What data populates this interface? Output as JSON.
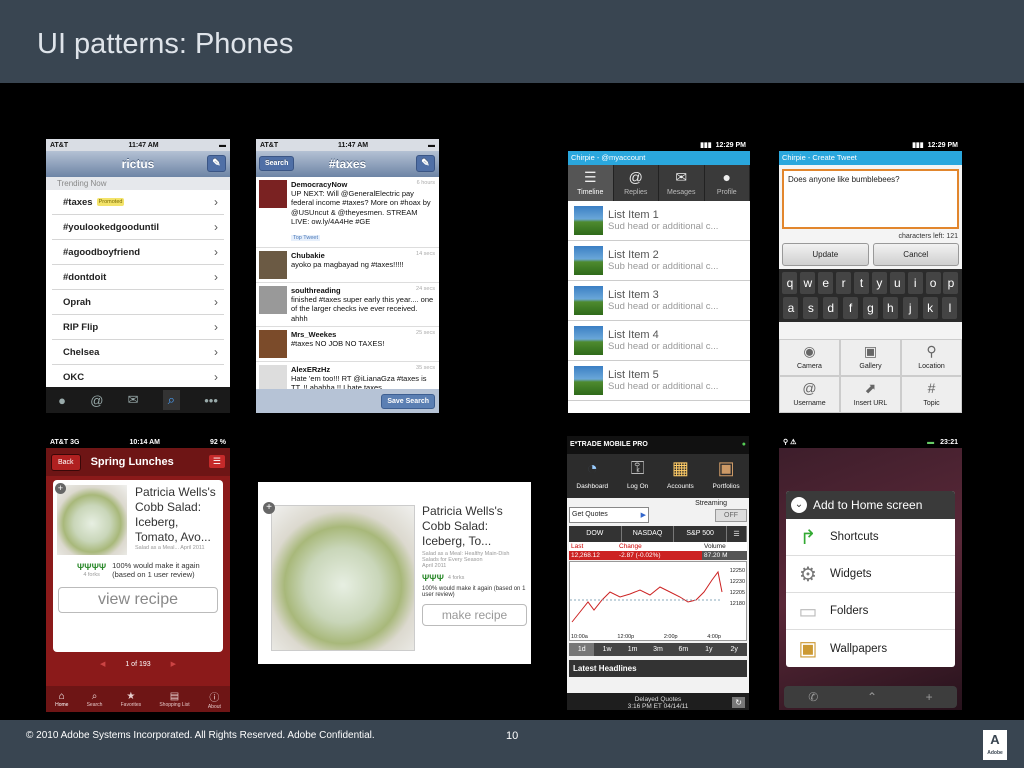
{
  "slide": {
    "title": "UI patterns: Phones",
    "footer": "© 2010 Adobe Systems Incorporated.  All Rights Reserved.  Adobe Confidential.",
    "page": "10",
    "logo": "Adobe"
  },
  "phone1": {
    "carrier": "AT&T",
    "time": "11:47 AM",
    "title": "rictus",
    "section": "Trending Now",
    "promoted": "Promoted",
    "items": [
      "#taxes",
      "#youlookedgooduntil",
      "#agoodboyfriend",
      "#dontdoit",
      "Oprah",
      "RIP Flip",
      "Chelsea",
      "OKC"
    ]
  },
  "phone2": {
    "carrier": "AT&T",
    "time": "11:47 AM",
    "back": "Search",
    "title": "#taxes",
    "save": "Save Search",
    "top_tweet": "Top Tweet",
    "tweets": [
      {
        "user": "DemocracyNow",
        "time": "6 hours",
        "text": "UP NEXT: Will @GeneralElectric pay federal income #taxes? More on #hoax by @USUncut & @theyesmen. STREAM LIVE: ow.ly/4A4He #GE"
      },
      {
        "user": "Chubakie",
        "time": "14 secs",
        "text": "ayoko pa magbayad ng #taxes!!!!!"
      },
      {
        "user": "soulthreading",
        "time": "24 secs",
        "text": "finished #taxes super early this year....  one of the larger checks ive ever received. ahhh"
      },
      {
        "user": "Mrs_Weekes",
        "time": "25 secs",
        "text": "#taxes NO JOB NO TAXES!"
      },
      {
        "user": "AlexERzHz",
        "time": "35 secs",
        "text": "Hate 'em too!!! RT @iLianaGza #taxes is TT. !! ahahha !! I hate taxes"
      }
    ]
  },
  "phone3": {
    "time": "12:29 PM",
    "header": "Chirpie - @myaccount",
    "tabs": [
      "Timeline",
      "Replies",
      "Mesages",
      "Profile"
    ],
    "items": [
      {
        "title": "List Item 1",
        "sub": "Sud head or additional c..."
      },
      {
        "title": "List Item 2",
        "sub": "Sub head or additional c..."
      },
      {
        "title": "List Item 3",
        "sub": "Sud head or additional c..."
      },
      {
        "title": "List Item 4",
        "sub": "Sud head or additional c..."
      },
      {
        "title": "List Item 5",
        "sub": "Sud head or additional c..."
      }
    ]
  },
  "phone4": {
    "time": "12:29 PM",
    "header": "Chirpie - Create Tweet",
    "text": "Does anyone like bumblebees?",
    "chars": "characters left: 121",
    "update": "Update",
    "cancel": "Cancel",
    "keys1": [
      "q",
      "w",
      "e",
      "r",
      "t",
      "y",
      "u",
      "i",
      "o",
      "p"
    ],
    "keys2": [
      "a",
      "s",
      "d",
      "f",
      "g",
      "h",
      "j",
      "k",
      "l"
    ],
    "grid": [
      "Camera",
      "Gallery",
      "Location",
      "Username",
      "Insert URL",
      "Topic"
    ]
  },
  "phone5": {
    "carrier": "AT&T  3G",
    "time": "10:14 AM",
    "battery": "92 %",
    "back": "Back",
    "title": "Spring Lunches",
    "name": "Patricia Wells's Cobb Salad: Iceberg, Tomato, Avo...",
    "meta": "Salad as a Meal...      April 2011",
    "rating": "100% would make it again (based on 1 user review)",
    "forks": "4 forks",
    "button": "view recipe",
    "pager": "1 of 193",
    "tabs": [
      "Home",
      "Search",
      "Favorites",
      "Shopping List",
      "About"
    ]
  },
  "phone6": {
    "name": "Patricia Wells's Cobb Salad: Iceberg, To...",
    "meta": "Salad as a Meal: Healthy Main-Dish Salads for Every Season",
    "date": "April 2011",
    "forks": "4 forks",
    "rating": "100% would make it again (based on 1 user review)",
    "button": "make recipe"
  },
  "phone7": {
    "brand": "E*TRADE MOBILE PRO",
    "nav": [
      "Dashboard",
      "Log On",
      "Accounts",
      "Portfolios"
    ],
    "streaming": "Streaming",
    "off": "OFF",
    "quotes": "Get Quotes",
    "indices": [
      "DOW",
      "NASDAQ",
      "S&P 500"
    ],
    "cols": [
      "Last",
      "Change",
      "Volume"
    ],
    "vals": [
      "12,268.12",
      "-2.87 (-0.02%)",
      "87.20 M"
    ],
    "yticks": [
      "12250",
      "12230",
      "12205",
      "12180"
    ],
    "xticks": [
      "10:00a",
      "12:00p",
      "2:00p",
      "4:00p"
    ],
    "ranges": [
      "1d",
      "1w",
      "1m",
      "3m",
      "6m",
      "1y",
      "2y"
    ],
    "headlines": "Latest Headlines",
    "delayed": "Delayed Quotes",
    "when": "3:16 PM ET 04/14/11"
  },
  "phone8": {
    "time": "23:21",
    "title": "Add to Home screen",
    "items": [
      "Shortcuts",
      "Widgets",
      "Folders",
      "Wallpapers"
    ]
  }
}
